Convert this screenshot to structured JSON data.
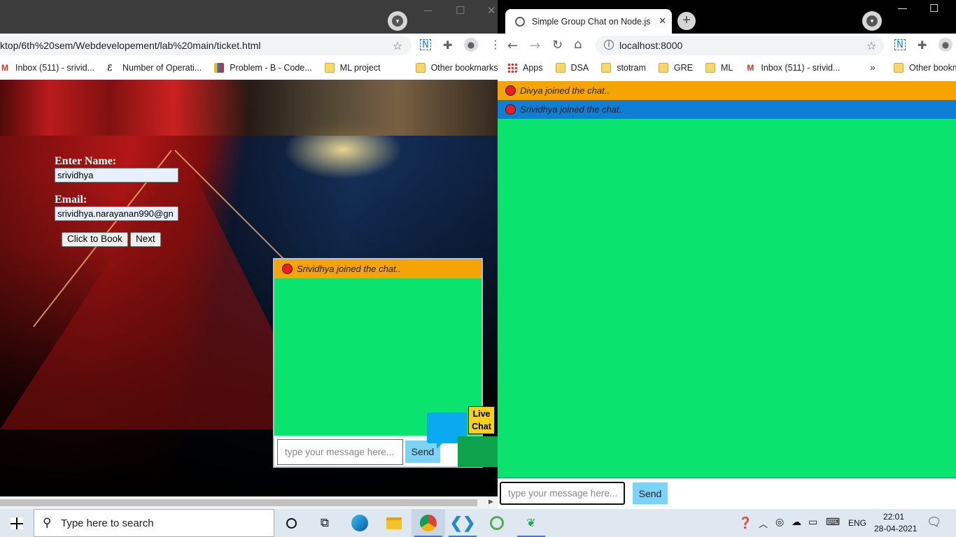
{
  "left_window": {
    "url_text": "ktop/6th%20sem/Webdevelopement/lab%20main/ticket.html",
    "bookmarks": [
      {
        "label": "Inbox (511) - srivid...",
        "icon": "gmail-icon"
      },
      {
        "label": "Number of Operati...",
        "icon": "code-icon"
      },
      {
        "label": "Problem - B - Code...",
        "icon": "chart-icon"
      },
      {
        "label": "ML project",
        "icon": "folder-icon"
      },
      {
        "label": "Other bookmarks",
        "icon": "folder-icon"
      }
    ],
    "form": {
      "name_label": "Enter Name:",
      "name_value": "srividhya",
      "email_label": "Email:",
      "email_value": "srividhya.narayanan990@gn",
      "book_button": "Click to Book",
      "next_button": "Next"
    },
    "mini_chat": {
      "message": "Srividhya joined the chat..",
      "input_placeholder": "type your message here...",
      "send_label": "Send",
      "live_chat_label_1": "Live",
      "live_chat_label_2": "Chat"
    }
  },
  "right_window": {
    "tab_title": "Simple Group Chat on Node.js",
    "url_text": "localhost:8000",
    "bookmarks": [
      {
        "label": "Apps",
        "icon": "apps-grid-icon"
      },
      {
        "label": "DSA",
        "icon": "folder-icon"
      },
      {
        "label": "stotram",
        "icon": "folder-icon"
      },
      {
        "label": "GRE",
        "icon": "folder-icon"
      },
      {
        "label": "ML",
        "icon": "folder-icon"
      },
      {
        "label": "Inbox (511) - srivid...",
        "icon": "gmail-icon"
      }
    ],
    "other_bookmarks": "Other bookm",
    "more_bookmarks": "»",
    "messages": [
      {
        "text": "Divya joined the chat..",
        "color": "#f6a400"
      },
      {
        "text": "Srividhya joined the chat..",
        "color": "#0f7fd6"
      }
    ],
    "chat_bg": "#0ae46e",
    "input_placeholder": "type your message here...",
    "send_label": "Send"
  },
  "taskbar": {
    "search_placeholder": "Type here to search",
    "language": "ENG",
    "time": "22:01",
    "date": "28-04-2021"
  }
}
